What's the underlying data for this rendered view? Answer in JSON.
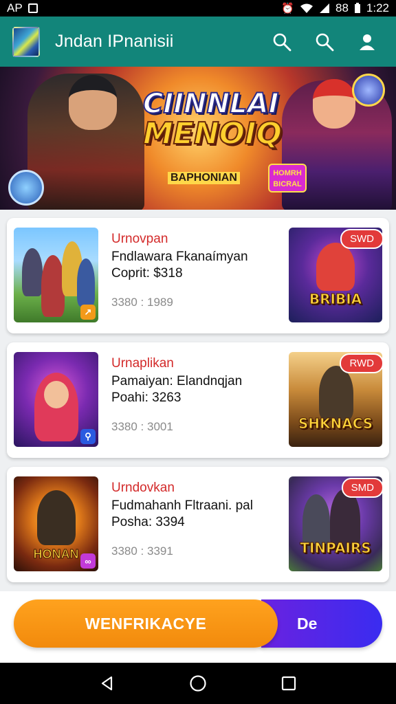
{
  "status_bar": {
    "carrier": "AP",
    "battery_text": "88",
    "time": "1:22"
  },
  "app_bar": {
    "title": "Jndan IPnanisii",
    "icons": [
      "search-icon",
      "search-icon",
      "profile-icon"
    ]
  },
  "banner": {
    "title_line1": "CIINNLAI",
    "title_line2": "MENOIQ",
    "subtitle": "BAPHONIAN",
    "badge": "HOMRH BICRAL"
  },
  "cards": [
    {
      "category": "Urnovpan",
      "name": "Fndlawara Fkanaímyan",
      "price": "Coprit: $318",
      "meta": "3380 : 1989",
      "promo_label": "BRIBIA",
      "promo_tag": "SWD",
      "thumb_badge": "↗"
    },
    {
      "category": "Urnaplikan",
      "name": "Pamaiyan: Elandnqjan",
      "price": "Poahi: 3263",
      "meta": "3380 : 3001",
      "promo_label": "SHKNACS",
      "promo_tag": "RWD",
      "thumb_badge": "⚲"
    },
    {
      "category": "Urndovkan",
      "name": "Fudmahanh Fltraani. pal",
      "price": "Posha: 3394",
      "meta": "3380 : 3391",
      "promo_label": "TINPAIRS",
      "promo_tag": "SMD",
      "thumb_badge": "∞",
      "thumb_label": "HONAN"
    }
  ],
  "bottom_actions": {
    "primary": "WENFRIKACYE",
    "secondary": "De"
  },
  "colors": {
    "app_bar": "#12857a",
    "category_text": "#d32a2a",
    "primary_button": "#f7921a",
    "secondary_button": "#5a25e6"
  }
}
